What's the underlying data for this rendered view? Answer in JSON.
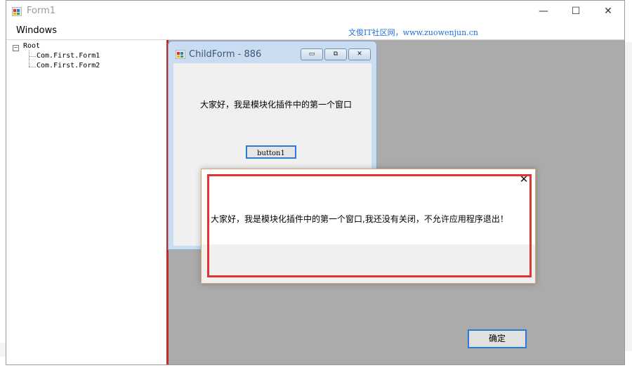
{
  "window": {
    "title": "Form1",
    "minimize": "—",
    "maximize": "☐",
    "close": "✕"
  },
  "menu": {
    "windows": "Windows"
  },
  "watermark": "文俊IT社区网，www.zuowenjun.cn",
  "tree": {
    "expander": "−",
    "root": "Root",
    "children": [
      "Com.First.Form1",
      "Com.First.Form2"
    ]
  },
  "child_form": {
    "title": "ChildForm - 886",
    "minimize": "▭",
    "restore": "⧉",
    "close": "✕",
    "label": "大家好，我是模块化插件中的第一个窗口",
    "button": "button1"
  },
  "message_box": {
    "text": "大家好，我是模块化插件中的第一个窗口,我还没有关闭，不允许应用程序退出！",
    "close": "✕",
    "ok": "确定"
  },
  "colors": {
    "accent": "#2b7bd4",
    "annotation": "#e23434",
    "mdi_background": "#ababab"
  }
}
